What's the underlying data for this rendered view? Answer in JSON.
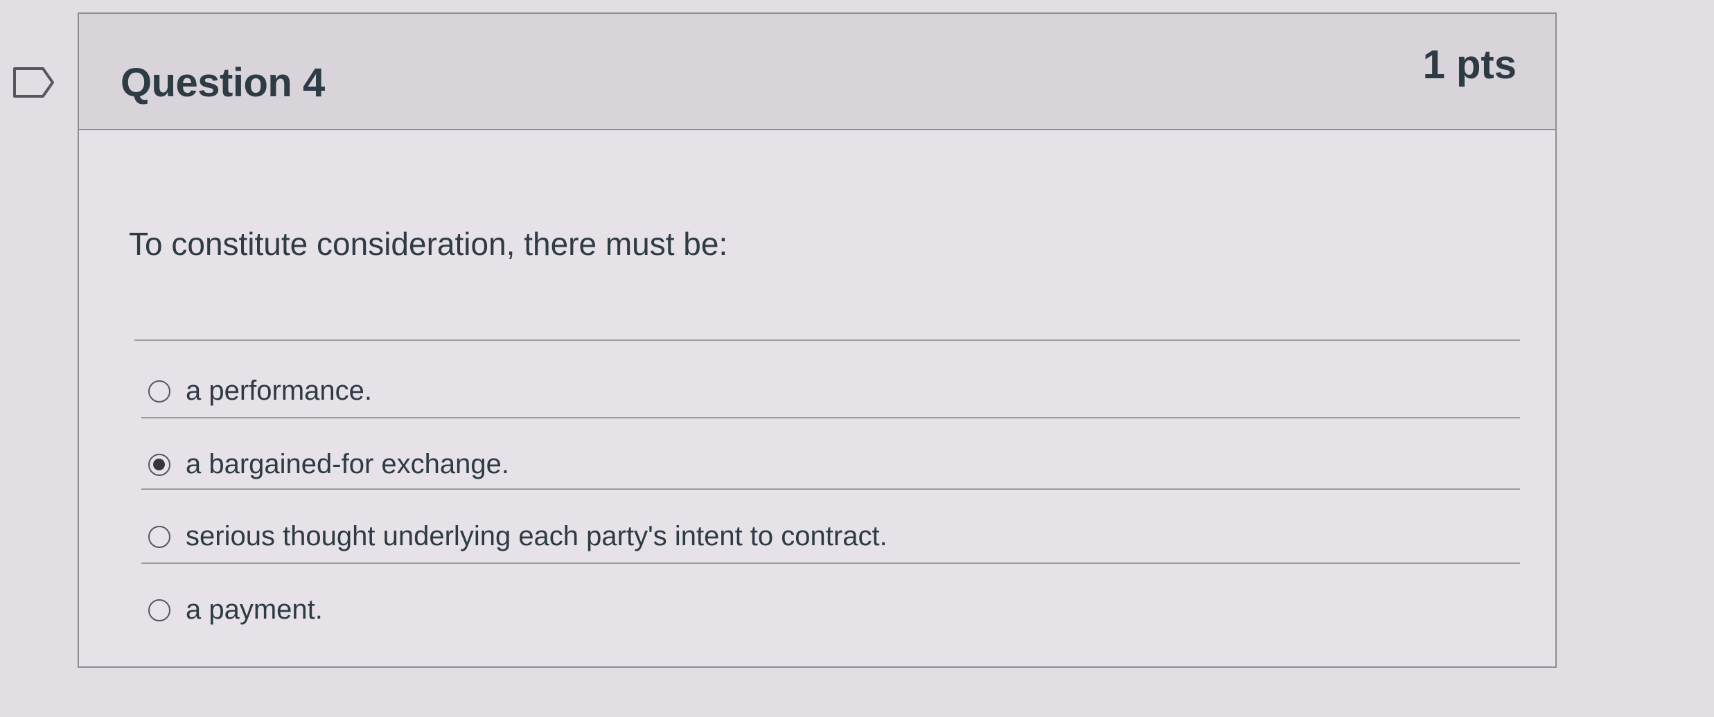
{
  "question": {
    "title": "Question 4",
    "points": "1 pts",
    "text": "To constitute consideration, there must be:",
    "selected_index": 1,
    "answers": [
      {
        "label": "a performance.",
        "selected": false
      },
      {
        "label": "a bargained-for exchange.",
        "selected": true
      },
      {
        "label": "serious thought underlying each party's intent to contract.",
        "selected": false
      },
      {
        "label": "a payment.",
        "selected": false
      }
    ]
  },
  "icons": {
    "flag": "flag-question-icon",
    "radio_unchecked": "radio-unchecked-icon",
    "radio_checked": "radio-checked-icon"
  },
  "colors": {
    "background": "#e3dde4",
    "header_background": "#d9d3da",
    "text": "#2d3b45",
    "border": "#8e8e93"
  }
}
